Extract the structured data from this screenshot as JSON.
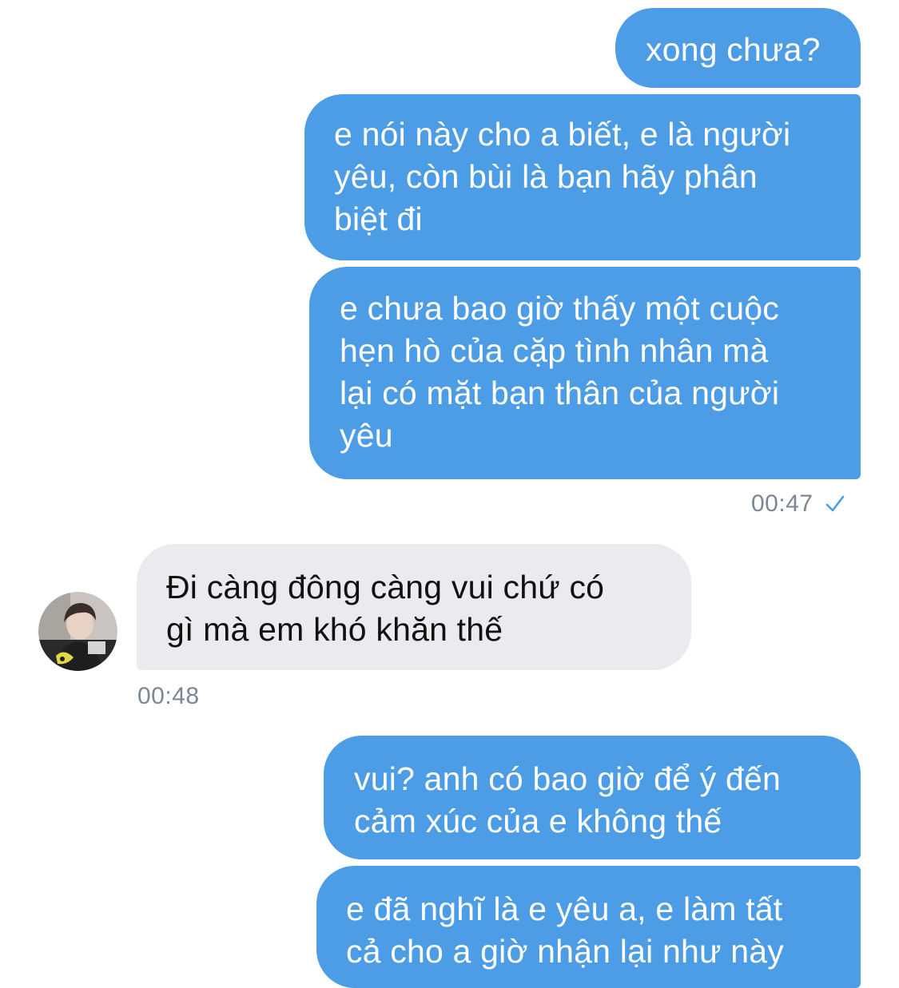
{
  "conversation": {
    "messages": [
      {
        "direction": "outgoing",
        "text": "xong chưa?"
      },
      {
        "direction": "outgoing",
        "text": "e nói này cho a biết, e là người\nyêu, còn bùi là bạn hãy phân\nbiệt đi"
      },
      {
        "direction": "outgoing",
        "text": "e chưa bao giờ thấy một cuộc\nhẹn hò của cặp tình nhân mà\nlại có mặt bạn thân của người\nyêu"
      },
      {
        "direction": "incoming",
        "text": "Đi càng đông càng vui chứ có\ngì mà em khó khăn thế"
      },
      {
        "direction": "outgoing",
        "text": "vui? anh có bao giờ để ý đến\ncảm xúc của e không thế"
      },
      {
        "direction": "outgoing",
        "text": "e đã nghĩ là e yêu a, e làm tất\ncả cho a giờ nhận lại như này"
      }
    ],
    "timestamps": {
      "outgoing_group_1": "00:47",
      "incoming_group_1": "00:48"
    },
    "icons": {
      "read_receipt": "checkmark-icon",
      "contact_avatar": "avatar"
    }
  },
  "colors": {
    "outgoing_bubble": "#4d9de6",
    "incoming_bubble": "#e9ebee",
    "timestamp": "#7b8794",
    "check": "#4d9de6"
  }
}
